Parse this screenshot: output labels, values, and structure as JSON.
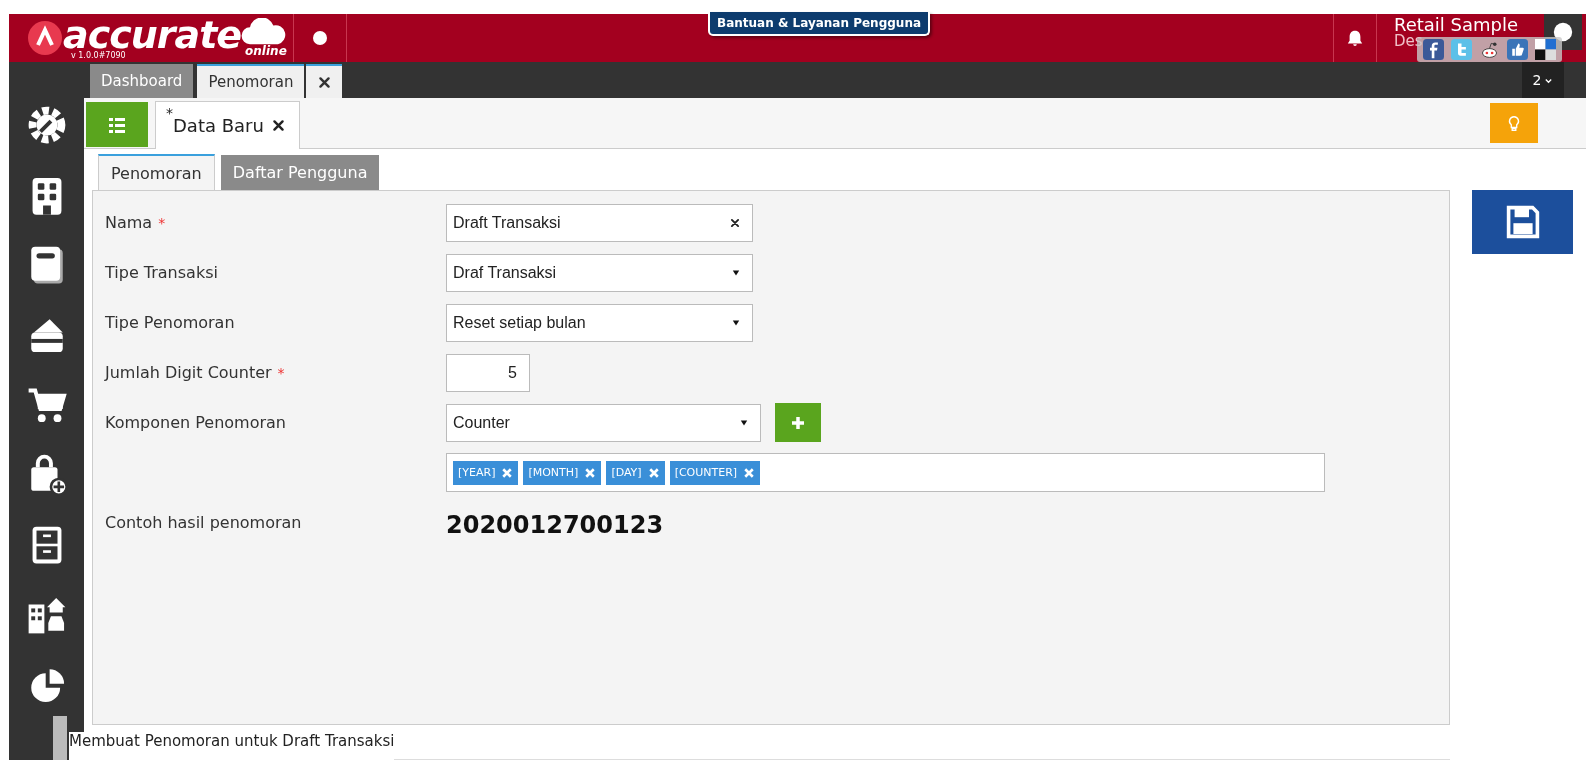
{
  "header": {
    "logo": "accurate",
    "logo_sub": "online",
    "version": "v 1.0.0#7090",
    "help_button": "Bantuan & Layanan Pengguna",
    "company": "Retail Sample",
    "company_sub": "Des"
  },
  "module_tabs": [
    {
      "label": "Dashboard",
      "selected": false,
      "closable": false
    },
    {
      "label": "Penomoran",
      "selected": true,
      "closable": true
    }
  ],
  "tab_counter": "2",
  "doc_tabs": [
    {
      "marker": "*",
      "label": "Data Baru",
      "selected": true
    }
  ],
  "form_tabs": [
    {
      "label": "Penomoran",
      "selected": true
    },
    {
      "label": "Daftar Pengguna",
      "selected": false
    }
  ],
  "fields": [
    {
      "kind": "text",
      "label": "Nama",
      "required_mark": "*",
      "value": "Draft Transaksi"
    },
    {
      "kind": "select",
      "label": "Tipe Transaksi",
      "value": "Draf Transaksi"
    },
    {
      "kind": "select",
      "label": "Tipe Penomoran",
      "value": "Reset setiap bulan"
    },
    {
      "kind": "number",
      "label": "Jumlah Digit Counter",
      "required_mark": "*",
      "value": "5"
    },
    {
      "kind": "select_add",
      "label": "Komponen Penomoran",
      "value": "Counter"
    },
    {
      "kind": "tags",
      "tags": [
        "[YEAR]",
        "[MONTH]",
        "[DAY]",
        "[COUNTER]"
      ]
    },
    {
      "kind": "preview",
      "label": "Contoh hasil penomoran",
      "value": "2020012700123"
    }
  ],
  "caption": "Membuat Penomoran untuk Draft Transaksi"
}
